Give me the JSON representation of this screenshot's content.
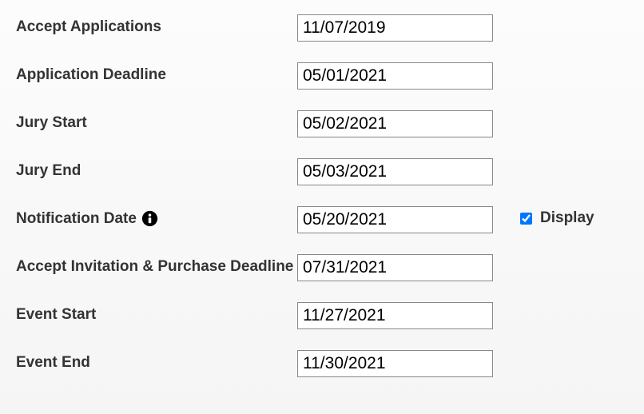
{
  "fields": {
    "accept_applications": {
      "label": "Accept Applications",
      "value": "11/07/2019"
    },
    "application_deadline": {
      "label": "Application Deadline",
      "value": "05/01/2021"
    },
    "jury_start": {
      "label": "Jury Start",
      "value": "05/02/2021"
    },
    "jury_end": {
      "label": "Jury End",
      "value": "05/03/2021"
    },
    "notification_date": {
      "label": "Notification Date",
      "value": "05/20/2021",
      "display_label": "Display"
    },
    "accept_invitation": {
      "label": "Accept Invitation & Purchase Deadline",
      "value": "07/31/2021"
    },
    "event_start": {
      "label": "Event Start",
      "value": "11/27/2021"
    },
    "event_end": {
      "label": "Event End",
      "value": "11/30/2021"
    }
  }
}
